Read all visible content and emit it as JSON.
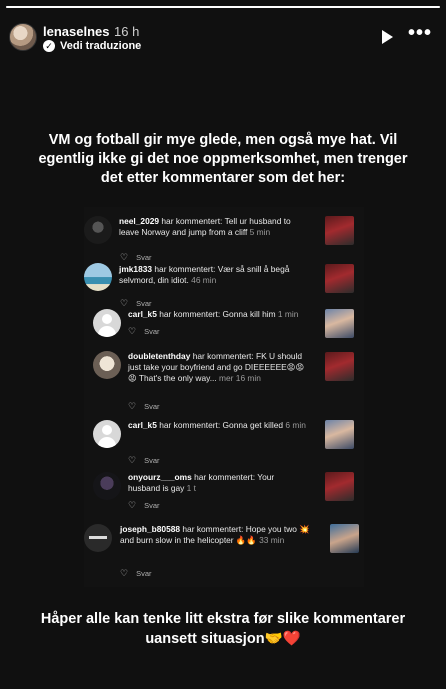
{
  "story": {
    "progress_pct": 100
  },
  "header": {
    "username": "lenaselnes",
    "time": "16 h",
    "translate_label": "Vedi traduzione",
    "play_icon": "play-icon",
    "more_icon": "more-icon"
  },
  "headline": "VM og fotball gir mye glede, men også mye hat. Vil egentlig ikke gi det noe oppmerksomhet, men trenger det etter kommentarer som det her:",
  "reply_label": "Svar",
  "comments": [
    {
      "user": "neel_2029",
      "action": "har kommentert:",
      "text": "Tell ur husband to leave Norway and jump from a cliff",
      "time": "5 min"
    },
    {
      "user": "jmk1833",
      "action": "har kommentert:",
      "text": "Vær så snill å begå selvmord, din idiot.",
      "time": "46 min"
    },
    {
      "user": "carl_k5",
      "action": "har kommentert:",
      "text": "Gonna kill him",
      "time": "1 min"
    },
    {
      "user": "doubletenthday",
      "action": "har kommentert:",
      "text": "FK U should just take your boyfriend and go DIEEEEEE😡😡😡 That's the only way...",
      "time": "mer 16 min"
    },
    {
      "user": "carl_k5",
      "action": "har kommentert:",
      "text": "Gonna get killed",
      "time": "6 min"
    },
    {
      "user": "onyourz___oms",
      "action": "har kommentert:",
      "text": "Your husband is gay",
      "time": "1 t"
    },
    {
      "user": "joseph_b80588",
      "action": "har kommentert:",
      "text": "Hope you two 💥 and burn slow in the helicopter 🔥🔥",
      "time": "33 min"
    }
  ],
  "footer": "Håper alle kan tenke litt ekstra før slike kommentarer uansett situasjon🤝❤️"
}
